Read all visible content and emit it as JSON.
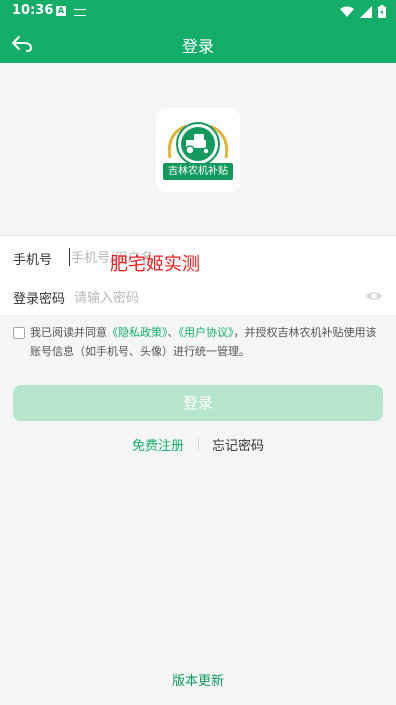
{
  "status_bar": {
    "time": "10:36",
    "notification_letter": "A",
    "icons": [
      "wifi-icon",
      "signal-icon",
      "battery-icon"
    ]
  },
  "app_bar": {
    "back_icon": "back-arrow-icon",
    "title": "登录"
  },
  "logo": {
    "text": "吉林农机补贴",
    "icon": "tractor-icon"
  },
  "form": {
    "phone": {
      "label": "手机号",
      "placeholder": "手机号/用户名",
      "value": ""
    },
    "password": {
      "label": "登录密码",
      "placeholder": "请输入密码",
      "toggle_icon": "eye-icon"
    }
  },
  "overlay_text": "肥宅姬实测",
  "agreement": {
    "prefix": "我已阅读并同意",
    "privacy_link": "《隐私政策》",
    "separator": "、",
    "user_link": "《用户协议》",
    "suffix": "，并授权吉林农机补贴使用该账号信息（如手机号、头像）进行统一管理。"
  },
  "login_button": "登录",
  "links": {
    "register": "免费注册",
    "forgot": "忘记密码"
  },
  "version_update": "版本更新",
  "colors": {
    "primary": "#14ae68",
    "button_disabled": "#b6e5cd",
    "overlay_red": "#f21e1e",
    "background": "#f4f5f7"
  }
}
